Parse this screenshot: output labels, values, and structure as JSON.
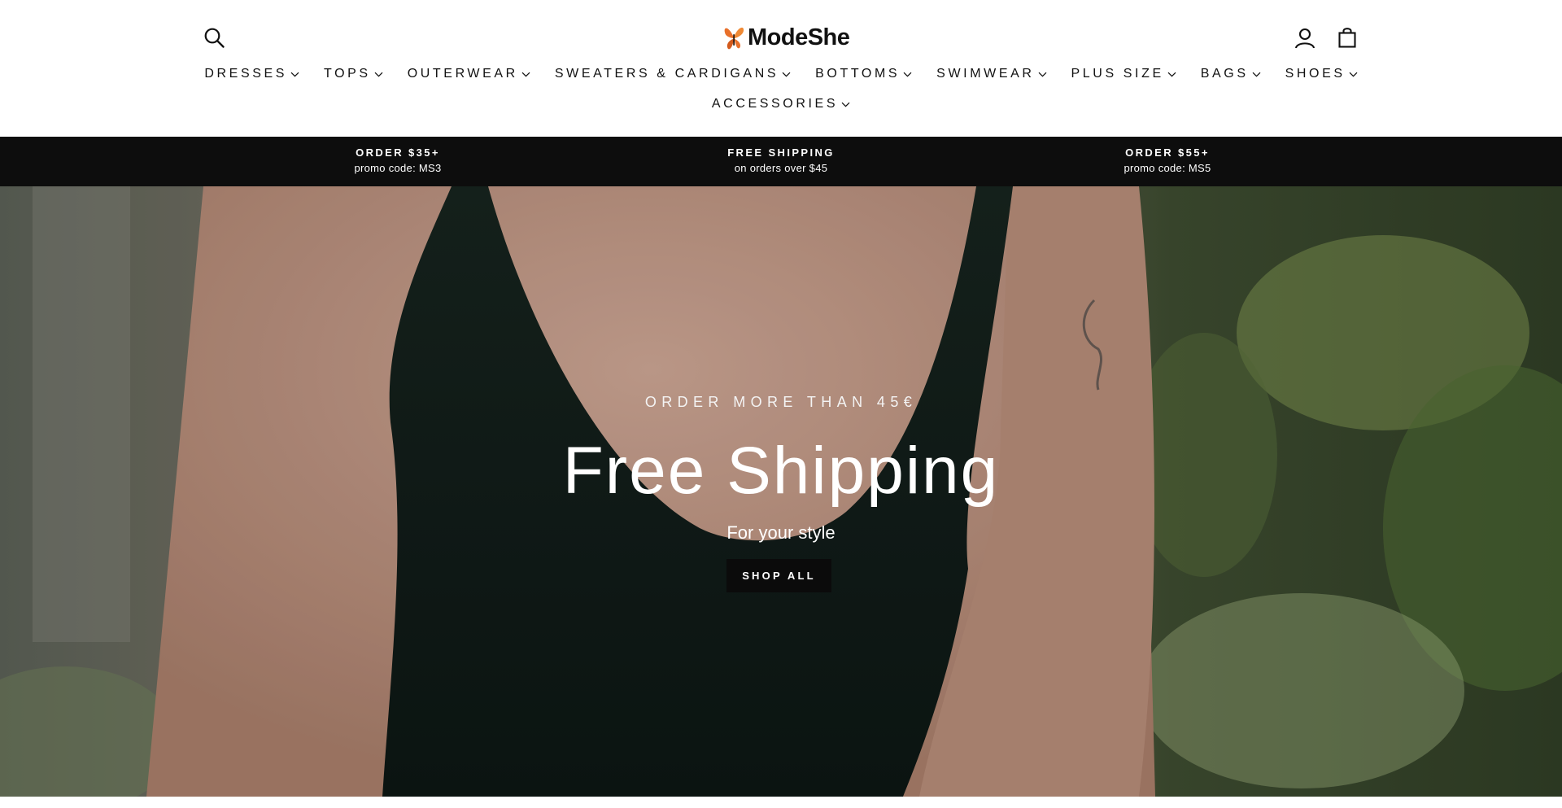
{
  "header": {
    "logo_text": "ModeShe",
    "logo_icon": "butterfly-logo-icon",
    "search_icon": "search-icon",
    "account_icon": "account-icon",
    "cart_icon": "shopping-bag-icon",
    "brand_accent_color": "#e8702a"
  },
  "nav": {
    "row1": [
      {
        "label": "DRESSES"
      },
      {
        "label": "TOPS"
      },
      {
        "label": "OUTERWEAR"
      },
      {
        "label": "SWEATERS & CARDIGANS"
      },
      {
        "label": "BOTTOMS"
      },
      {
        "label": "SWIMWEAR"
      },
      {
        "label": "PLUS SIZE"
      },
      {
        "label": "BAGS"
      },
      {
        "label": "SHOES"
      }
    ],
    "row2": [
      {
        "label": "ACCESSORIES"
      }
    ],
    "chevron_icon": "chevron-down-icon"
  },
  "announcements": [
    {
      "title": "ORDER $35+",
      "subtitle": "promo code: MS3"
    },
    {
      "title": "FREE SHIPPING",
      "subtitle": "on orders over $45"
    },
    {
      "title": "ORDER $55+",
      "subtitle": "promo code: MS5"
    }
  ],
  "hero": {
    "subheading": "ORDER MORE THAN 45€",
    "title": "Free Shipping",
    "text": "For your style",
    "button_label": "SHOP ALL"
  },
  "colors": {
    "announcement_bg": "#0d0d0d",
    "button_bg": "#0b0b0b",
    "text": "#111111"
  }
}
